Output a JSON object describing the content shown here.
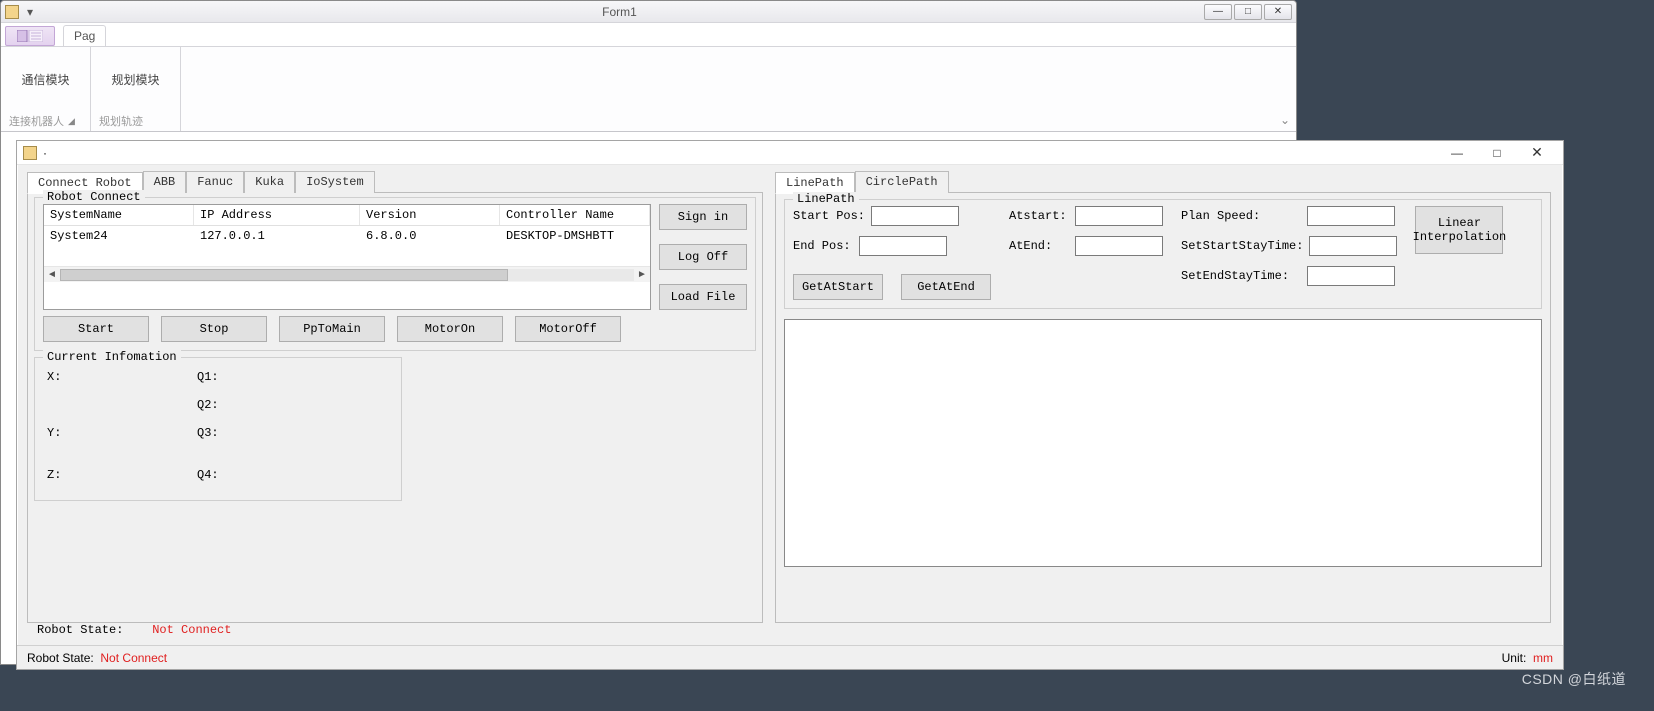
{
  "outer": {
    "title": "Form1",
    "ribbon_tab": "Pag",
    "groups": [
      {
        "big": "通信模块",
        "name": "连接机器人"
      },
      {
        "big": "规划模块",
        "name": "规划轨迹"
      }
    ]
  },
  "inner": {
    "tabs_left": [
      "Connect Robot",
      "ABB",
      "Fanuc",
      "Kuka",
      "IoSystem"
    ],
    "tabs_right": [
      "LinePath",
      "CirclePath"
    ],
    "robot_connect_legend": "Robot Connect",
    "lv_headers": [
      "SystemName",
      "IP Address",
      "Version",
      "Controller Name"
    ],
    "lv_row": [
      "System24",
      "127.0.0.1",
      "6.8.0.0",
      "DESKTOP-DMSHBTT"
    ],
    "side_buttons": [
      "Sign in",
      "Log Off",
      "Load File"
    ],
    "row_buttons": [
      "Start",
      "Stop",
      "PpToMain",
      "MotorOn",
      "MotorOff"
    ],
    "curinfo_legend": "Current Infomation",
    "curinfo_left": [
      "X:",
      "Y:",
      "Z:"
    ],
    "curinfo_right": [
      "Q1:",
      "Q2:",
      "Q3:",
      "Q4:"
    ],
    "robot_state_label": "Robot State:",
    "robot_state_value": "Not Connect",
    "linepath_legend": "LinePath",
    "linepath_labels": {
      "startpos": "Start Pos:",
      "endpos": "End Pos:",
      "atstart": "Atstart:",
      "atend": "AtEnd:",
      "plan": "Plan Speed:",
      "setstart": "SetStartStayTime:",
      "setend": "SetEndStayTime:",
      "getstart": "GetAtStart",
      "getend": "GetAtEnd",
      "interp": "Linear Interpolation"
    }
  },
  "statusbar": {
    "label": "Robot State:",
    "value": "Not Connect",
    "unit_label": "Unit:",
    "unit_value": "mm"
  },
  "watermark": "CSDN @白纸道"
}
